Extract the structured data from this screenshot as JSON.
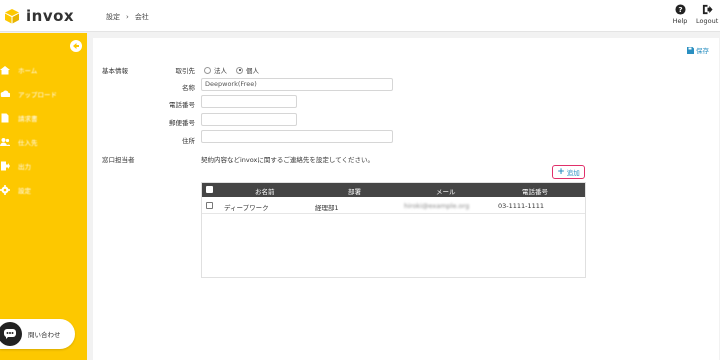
{
  "header": {
    "app_name": "invox",
    "breadcrumb": [
      "設定",
      "会社"
    ],
    "breadcrumb_sep": "›",
    "help_label": "Help",
    "logout_label": "Logout",
    "brand_color": "#fdc800"
  },
  "sidebar": {
    "items": [
      {
        "label": "ホーム",
        "icon": "home-icon"
      },
      {
        "label": "アップロード",
        "icon": "upload-icon"
      },
      {
        "label": "請求書",
        "icon": "document-icon"
      },
      {
        "label": "仕入先",
        "icon": "users-icon"
      },
      {
        "label": "出力",
        "icon": "export-icon"
      },
      {
        "label": "設定",
        "icon": "gear-icon"
      }
    ],
    "contact_label": "問い合わせ"
  },
  "form": {
    "save_label": "保存",
    "section_basic": "基本情報",
    "partner_type_label": "取引先",
    "partner_options": [
      "法人",
      "個人"
    ],
    "partner_selected": "個人",
    "name_label": "名称",
    "name_value": "Deepwork(Free)",
    "phone_label": "電話番号",
    "phone_value": "",
    "zip_label": "郵便番号",
    "zip_value": "",
    "address_label": "住所",
    "address_value": "",
    "section_contact": "窓口担当者",
    "contact_desc": "契約内容などinvoxに関するご連絡先を設定してください。",
    "add_label": "追加"
  },
  "table": {
    "columns": [
      "お名前",
      "部署",
      "メール",
      "電話番号"
    ],
    "rows": [
      {
        "name": "ディープワーク",
        "dept": "経理部1",
        "email": "hiroki@example.org",
        "phone": "03-1111-1111"
      }
    ]
  }
}
